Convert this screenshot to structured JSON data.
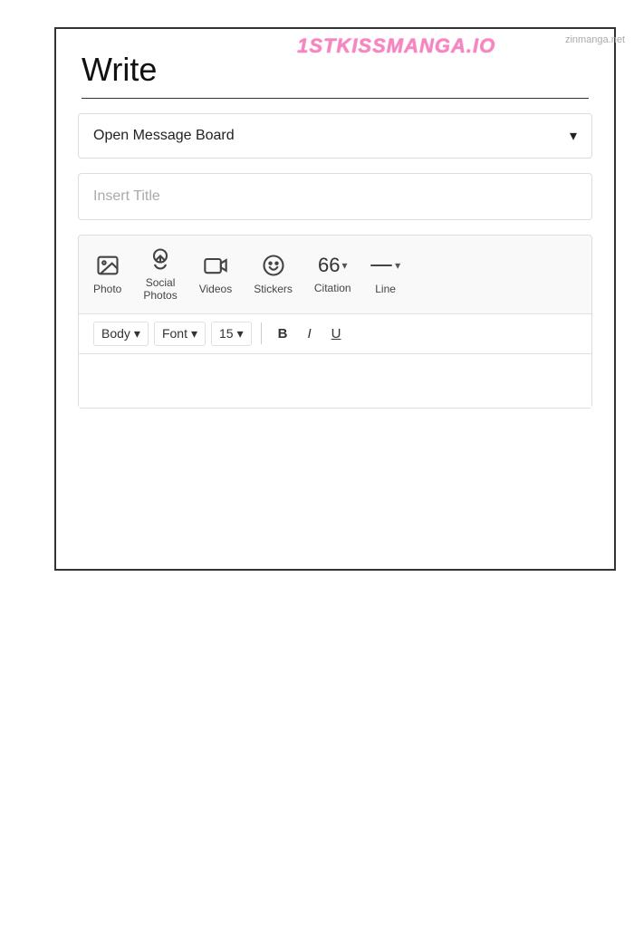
{
  "watermark": {
    "text": "1STKISSMANGA.IO",
    "sub": "zinmanga.net"
  },
  "page": {
    "title": "Write"
  },
  "board_selector": {
    "label": "Open Message Board",
    "chevron": "▾"
  },
  "title_input": {
    "placeholder": "Insert Title"
  },
  "toolbar": {
    "icons": [
      {
        "name": "photo",
        "label": "Photo"
      },
      {
        "name": "social-photos",
        "label": "Social\nPhotos"
      },
      {
        "name": "videos",
        "label": "Videos"
      },
      {
        "name": "stickers",
        "label": "Stickers"
      }
    ],
    "citation": {
      "number": "66",
      "chevron": "▾",
      "label": "Citation"
    },
    "line": {
      "label": "Line",
      "chevron": "▾"
    }
  },
  "formatting": {
    "style_label": "Body",
    "font_label": "Font",
    "size_label": "15",
    "bold_label": "B",
    "italic_label": "I",
    "underline_label": "U"
  }
}
